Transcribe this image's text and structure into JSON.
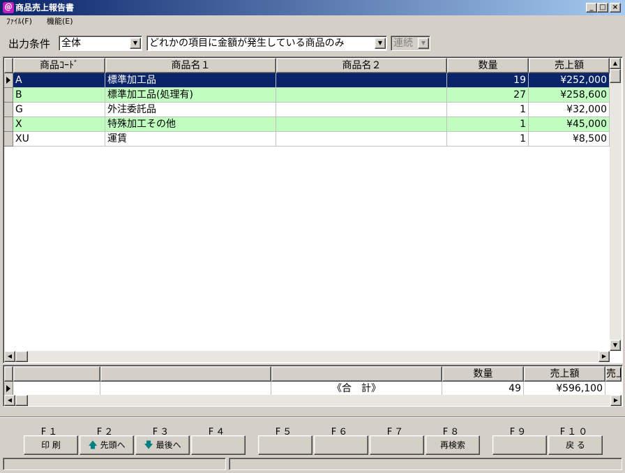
{
  "window": {
    "title": "商品売上報告書",
    "min": "_",
    "max": "□",
    "close": "×",
    "icon": "＠"
  },
  "menu": [
    {
      "label": "ﾌｧｲﾙ(F)"
    },
    {
      "label": "機能(E)"
    }
  ],
  "condition": {
    "label": "出力条件",
    "scope": "全体",
    "filter": "どれかの項目に金額が発生している商品のみ",
    "mode": "連続"
  },
  "table": {
    "headers": [
      "商品ｺｰﾄﾞ",
      "商品名１",
      "商品名２",
      "数量",
      "売上額"
    ],
    "rows": [
      {
        "code": "A",
        "name1": "標準加工品",
        "name2": "",
        "qty": "19",
        "amount": "¥252,000"
      },
      {
        "code": "B",
        "name1": "標準加工品(処理有)",
        "name2": "",
        "qty": "27",
        "amount": "¥258,600"
      },
      {
        "code": "G",
        "name1": "外注委託品",
        "name2": "",
        "qty": "1",
        "amount": "¥32,000"
      },
      {
        "code": "X",
        "name1": "特殊加工その他",
        "name2": "",
        "qty": "1",
        "amount": "¥45,000"
      },
      {
        "code": "XU",
        "name1": "運賃",
        "name2": "",
        "qty": "1",
        "amount": "¥8,500"
      }
    ]
  },
  "total": {
    "headers": [
      "",
      "",
      "",
      "数量",
      "売上額",
      "売上"
    ],
    "label": "《合　計》",
    "qty": "49",
    "amount": "¥596,100"
  },
  "fkeys": [
    {
      "key": "F１",
      "label": "印 刷"
    },
    {
      "key": "F２",
      "label": "先頭へ",
      "icon": "arrow-up-icon"
    },
    {
      "key": "F３",
      "label": "最後へ",
      "icon": "arrow-down-icon"
    },
    {
      "key": "F４",
      "label": ""
    },
    {
      "key": "F５",
      "label": ""
    },
    {
      "key": "F６",
      "label": ""
    },
    {
      "key": "F７",
      "label": ""
    },
    {
      "key": "F８",
      "label": "再検索"
    },
    {
      "key": "F９",
      "label": ""
    },
    {
      "key": "F１０",
      "label": "戻 る"
    }
  ],
  "colors": {
    "selected": "#0a246a",
    "alt": "#c0ffc0",
    "arrow": "#008080"
  }
}
